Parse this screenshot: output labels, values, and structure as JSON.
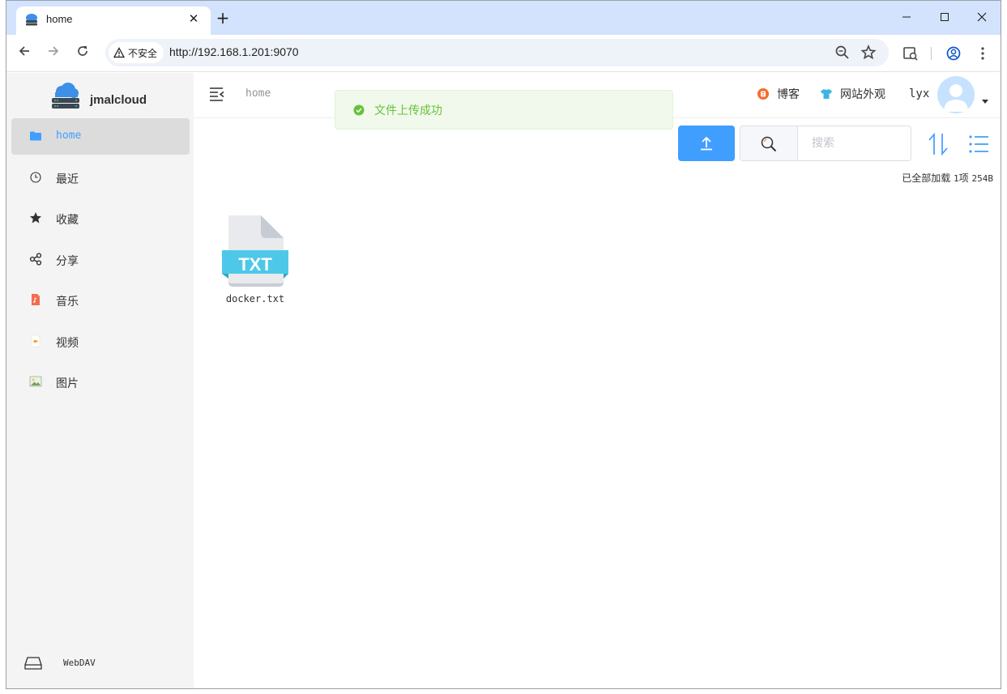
{
  "browser": {
    "tab_title": "home",
    "tab_close": "✕",
    "new_tab": "+",
    "security_label": "不安全",
    "url": "http://192.168.1.201:9070"
  },
  "app": {
    "brand": "jmalcloud",
    "breadcrumb": "home",
    "header_links": [
      "博客",
      "网站外观"
    ],
    "username": "lyx",
    "nav": [
      {
        "label": "home",
        "icon": "folder-icon",
        "active": true
      },
      {
        "label": "最近",
        "icon": "clock-icon"
      },
      {
        "label": "收藏",
        "icon": "star-icon"
      },
      {
        "label": "分享",
        "icon": "share-icon"
      },
      {
        "label": "音乐",
        "icon": "music-file-icon"
      },
      {
        "label": "视频",
        "icon": "video-file-icon"
      },
      {
        "label": "图片",
        "icon": "image-file-icon"
      }
    ],
    "webdav_label": "WebDAV",
    "search_placeholder": "搜索",
    "status": {
      "loaded": "已全部加载",
      "count": "1",
      "count_unit": "项",
      "size": "254B"
    },
    "files": [
      {
        "name": "docker.txt",
        "badge": "TXT",
        "icon": "txt-file-icon"
      }
    ],
    "toast": "文件上传成功"
  },
  "colors": {
    "accent": "#409eff",
    "success": "#67c23a",
    "tabstrip": "#d3e3fd",
    "txt_badge": "#4dc8e8"
  }
}
